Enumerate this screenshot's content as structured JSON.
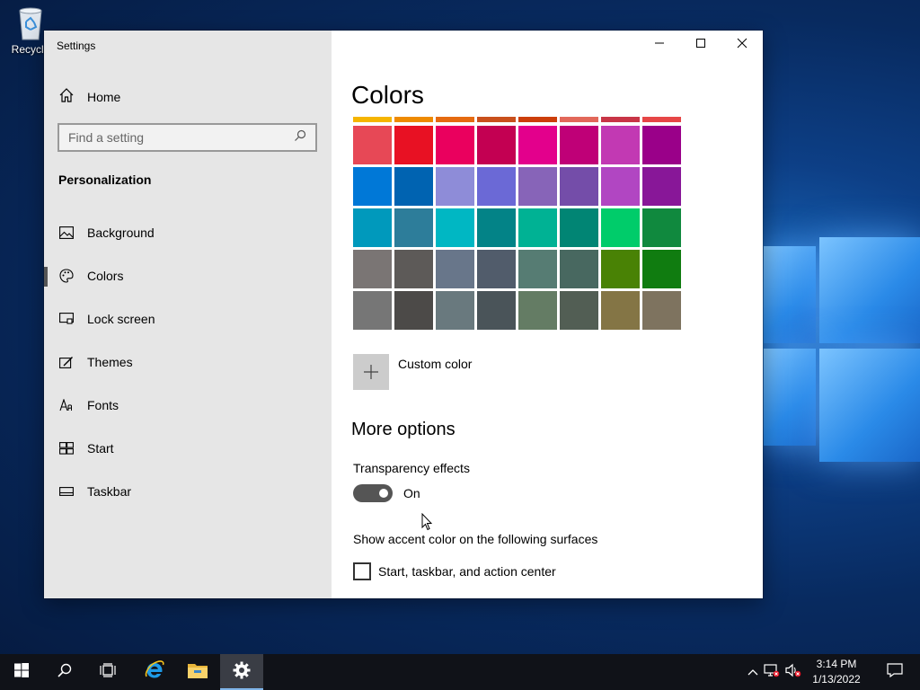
{
  "desktop": {
    "recycle_bin_label": "Recycle"
  },
  "window": {
    "app_title": "Settings",
    "controls": {
      "minimize": "minimize-icon",
      "maximize": "maximize-icon",
      "close": "close-icon"
    }
  },
  "sidebar": {
    "home_label": "Home",
    "search_placeholder": "Find a setting",
    "section_title": "Personalization",
    "items": [
      {
        "label": "Background",
        "icon": "picture-icon"
      },
      {
        "label": "Colors",
        "icon": "palette-icon",
        "selected": true
      },
      {
        "label": "Lock screen",
        "icon": "lock-screen-icon"
      },
      {
        "label": "Themes",
        "icon": "themes-icon"
      },
      {
        "label": "Fonts",
        "icon": "fonts-icon"
      },
      {
        "label": "Start",
        "icon": "start-layout-icon"
      },
      {
        "label": "Taskbar",
        "icon": "taskbar-icon"
      }
    ]
  },
  "content": {
    "page_title": "Colors",
    "top_strip": [
      "#f5b500",
      "#ee8a00",
      "#e56a10",
      "#c9501c",
      "#cc3e0a",
      "#e2685a",
      "#c83546",
      "#e64646"
    ],
    "swatches": [
      [
        "#e74856",
        "#e81123",
        "#ea005e",
        "#c30052",
        "#e3008c",
        "#bf0077",
        "#c239b3",
        "#9a0089"
      ],
      [
        "#0078d7",
        "#0063b1",
        "#8e8cd8",
        "#6b69d6",
        "#8764b8",
        "#744da9",
        "#b146c2",
        "#881798"
      ],
      [
        "#0099bc",
        "#2d7d9a",
        "#00b7c3",
        "#038387",
        "#00b294",
        "#018574",
        "#00cc6a",
        "#10893e"
      ],
      [
        "#7a7574",
        "#5d5a58",
        "#68768a",
        "#515c6b",
        "#567c73",
        "#486860",
        "#498205",
        "#107c10"
      ],
      [
        "#767676",
        "#4c4a48",
        "#69797e",
        "#4a5459",
        "#647c64",
        "#525e54",
        "#847545",
        "#7e735f"
      ]
    ],
    "custom_color_label": "Custom color",
    "more_options_title": "More options",
    "transparency_label": "Transparency effects",
    "transparency_state": "On",
    "transparency_on": true,
    "surfaces_label": "Show accent color on the following surfaces",
    "start_taskbar_label": "Start, taskbar, and action center",
    "start_taskbar_checked": false
  },
  "taskbar": {
    "apps": [
      "start-icon",
      "search-icon",
      "task-view-icon",
      "internet-explorer-icon",
      "file-explorer-icon",
      "settings-icon"
    ],
    "active_app": "settings-icon",
    "tray": [
      "chevron-up-icon",
      "network-icon",
      "volume-muted-icon",
      "action-center-icon"
    ],
    "time": "3:14 PM",
    "date": "1/13/2022"
  }
}
